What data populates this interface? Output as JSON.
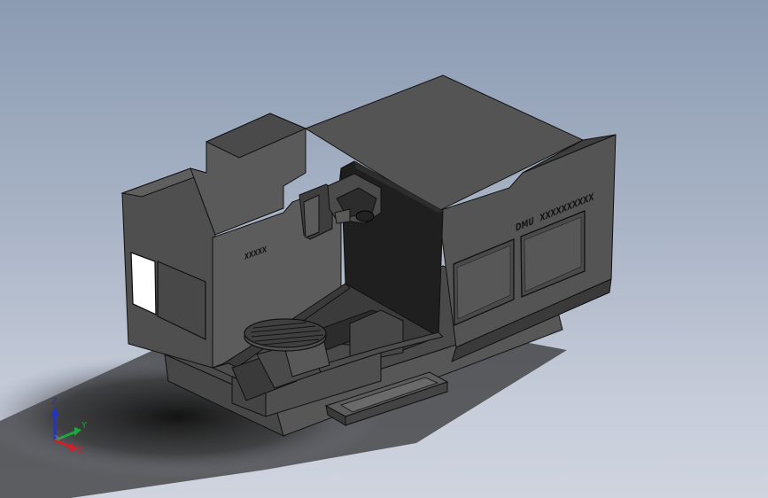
{
  "model": {
    "brand_text": "DMU",
    "series_text": "XXXXXXXXXX",
    "side_label_text": "XXXXX"
  },
  "triad": {
    "x_label": "X",
    "y_label": "Y",
    "z_label": "Z",
    "colors": {
      "x": "#d0202a",
      "y": "#19a83a",
      "z": "#2233c8"
    }
  }
}
